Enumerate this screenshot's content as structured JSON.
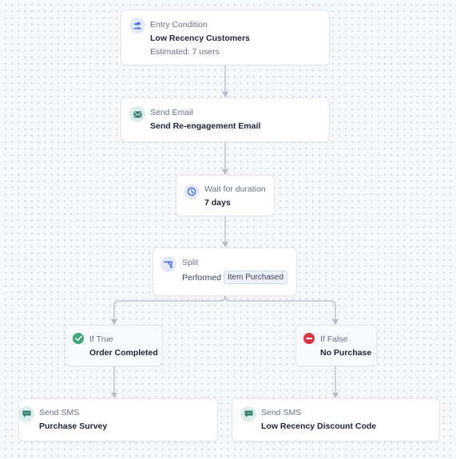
{
  "flow": {
    "entry": {
      "icon": "users-icon",
      "label": "Entry Condition",
      "title": "Low Recency Customers",
      "estimate": "Estimated: 7 users"
    },
    "send_email": {
      "icon": "envelope-icon",
      "label": "Send Email",
      "title": "Send Re-engagement Email"
    },
    "wait": {
      "icon": "clock-icon",
      "label": "Wait for duration",
      "title": "7 days"
    },
    "split": {
      "icon": "split-icon",
      "label": "Split",
      "condition_prefix": "Performed",
      "condition_value": "Item Purchased"
    },
    "branch_true": {
      "icon": "check-circle-icon",
      "label": "If True",
      "title": "Order Completed"
    },
    "branch_false": {
      "icon": "minus-circle-icon",
      "label": "If False",
      "title": "No Purchase"
    },
    "sms_true": {
      "icon": "sms-icon",
      "label": "Send SMS",
      "title": "Purchase Survey"
    },
    "sms_false": {
      "icon": "sms-icon",
      "label": "Send SMS",
      "title": "Low Recency Discount Code"
    }
  },
  "colors": {
    "connector": "#b6bccb",
    "success": "#3aa876",
    "danger": "#d8343f",
    "accent_blue": "#4a6fe3",
    "accent_teal": "#2f7a6b"
  }
}
